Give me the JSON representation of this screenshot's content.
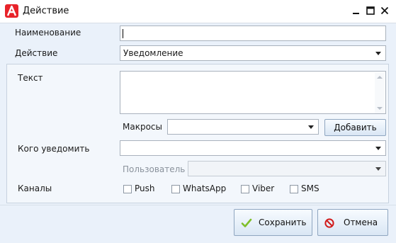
{
  "window": {
    "title": "Действие",
    "icon": "app-logo-a-icon",
    "controls": [
      "minimize-icon",
      "maximize-icon",
      "close-icon"
    ]
  },
  "form": {
    "name_label": "Наименование",
    "name_value": "",
    "action_label": "Действие",
    "action_value": "Уведомление",
    "text_label": "Текст",
    "text_value": "",
    "macros_label": "Макросы",
    "macros_value": "",
    "add_button": "Добавить",
    "notify_label": "Кого уведомить",
    "notify_value": "",
    "user_label": "Пользователь",
    "user_value": "",
    "channels_label": "Каналы",
    "channels": [
      {
        "label": "Push",
        "checked": false
      },
      {
        "label": "WhatsApp",
        "checked": false
      },
      {
        "label": "Viber",
        "checked": false
      },
      {
        "label": "SMS",
        "checked": false
      }
    ]
  },
  "footer": {
    "save_button": "Сохранить",
    "cancel_button": "Отмена"
  },
  "colors": {
    "brand": "#e8232a",
    "background": "#eaf1fa",
    "check_green": "#7fbf2a",
    "cancel_red": "#d11a1a"
  }
}
